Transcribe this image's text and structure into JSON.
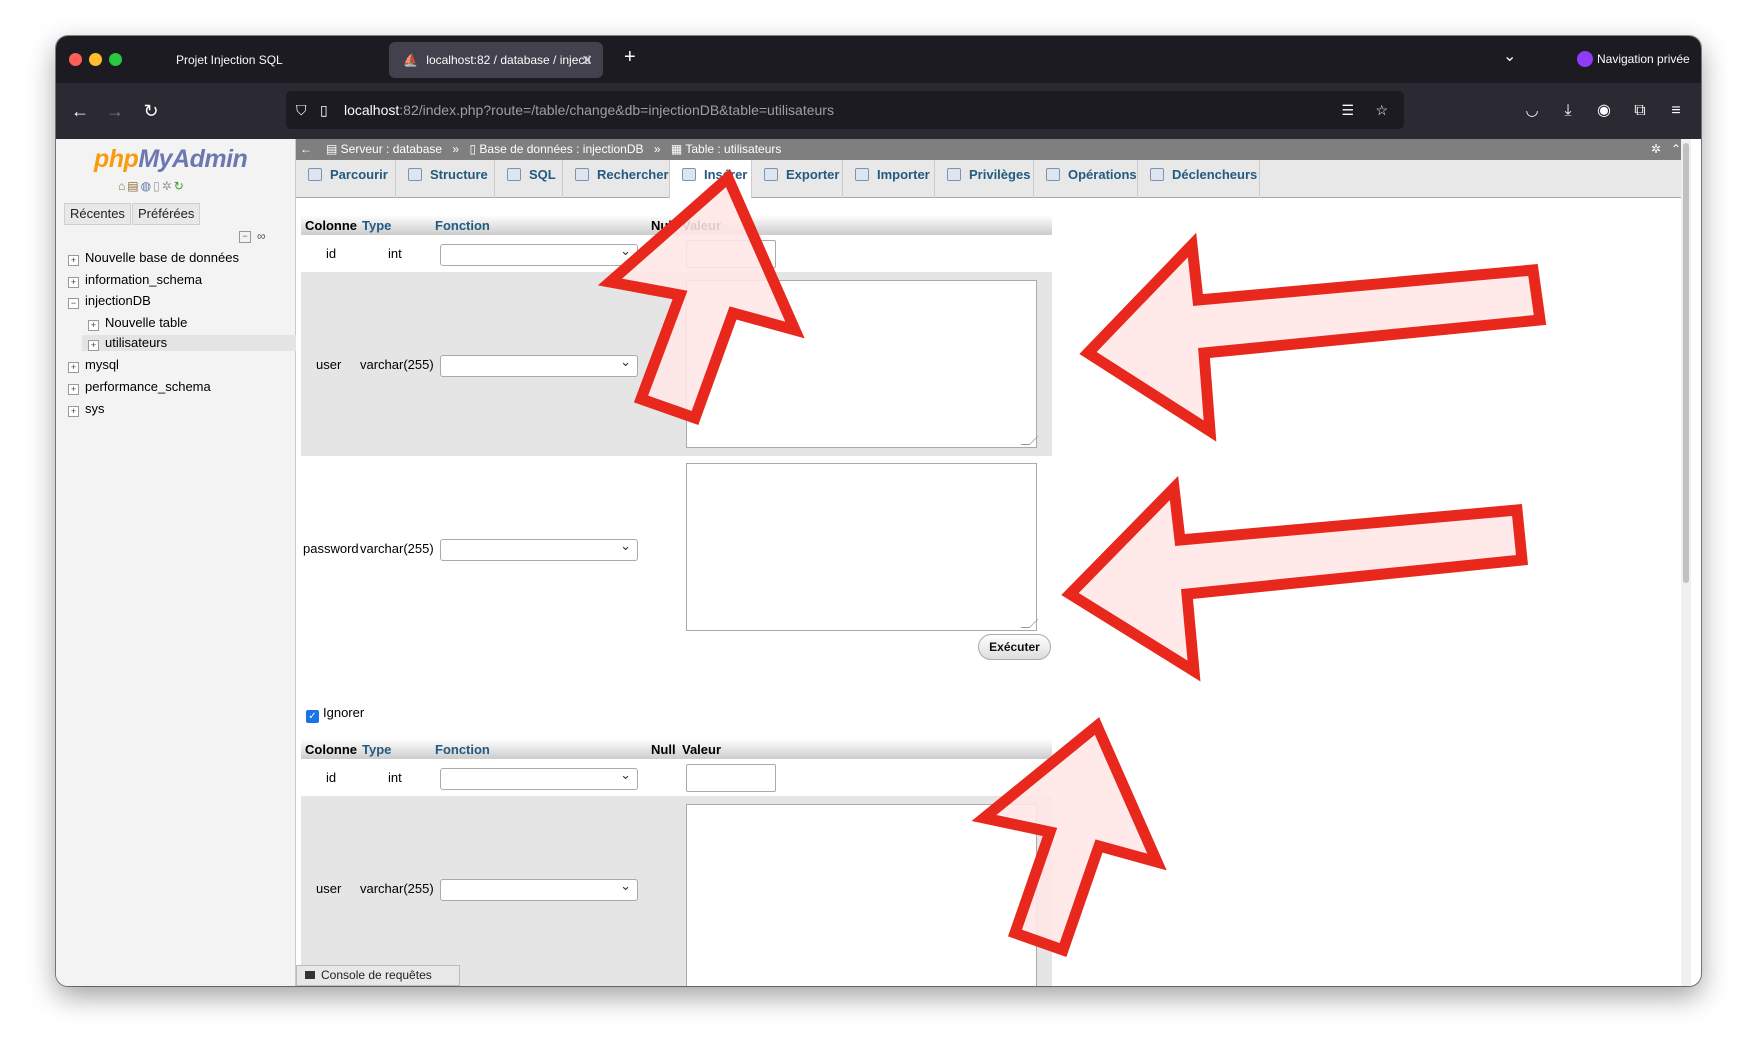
{
  "browser": {
    "tabs": [
      {
        "title": "Projet Injection SQL"
      },
      {
        "title": "localhost:82 / database / injecti"
      }
    ],
    "new_tab": "+",
    "private_label": "Navigation privée",
    "url_host": "localhost",
    "url_rest": ":82/index.php?route=/table/change&db=injectionDB&table=utilisateurs"
  },
  "sidebar": {
    "logo_php": "php",
    "logo_rest": "MyAdmin",
    "tab_recent": "Récentes",
    "tab_favorites": "Préférées",
    "tree": [
      {
        "label": "Nouvelle base de données"
      },
      {
        "label": "information_schema"
      },
      {
        "label": "injectionDB"
      },
      {
        "label": "Nouvelle table"
      },
      {
        "label": "utilisateurs"
      },
      {
        "label": "mysql"
      },
      {
        "label": "performance_schema"
      },
      {
        "label": "sys"
      }
    ]
  },
  "breadcrumb": {
    "server": "Serveur : database",
    "sep": "»",
    "database": "Base de données : injectionDB",
    "table": "Table : utilisateurs"
  },
  "tabs": [
    {
      "label": "Parcourir"
    },
    {
      "label": "Structure"
    },
    {
      "label": "SQL"
    },
    {
      "label": "Rechercher"
    },
    {
      "label": "Insérer"
    },
    {
      "label": "Exporter"
    },
    {
      "label": "Importer"
    },
    {
      "label": "Privilèges"
    },
    {
      "label": "Opérations"
    },
    {
      "label": "Déclencheurs"
    }
  ],
  "form": {
    "header": {
      "column": "Colonne",
      "type": "Type",
      "function": "Fonction",
      "null": "Null",
      "value": "Valeur"
    },
    "rows": [
      {
        "column": "id",
        "type": "int"
      },
      {
        "column": "user",
        "type": "varchar(255)"
      },
      {
        "column": "password",
        "type": "varchar(255)"
      }
    ],
    "execute_label": "Exécuter",
    "ignore_label": "Ignorer",
    "ignore_checked": true,
    "rows2": [
      {
        "column": "id",
        "type": "int"
      },
      {
        "column": "user",
        "type": "varchar(255)"
      }
    ]
  },
  "console_label": "Console de requêtes SQL",
  "colors": {
    "annotation_arrow": "#e8281d",
    "link": "#235a81"
  }
}
